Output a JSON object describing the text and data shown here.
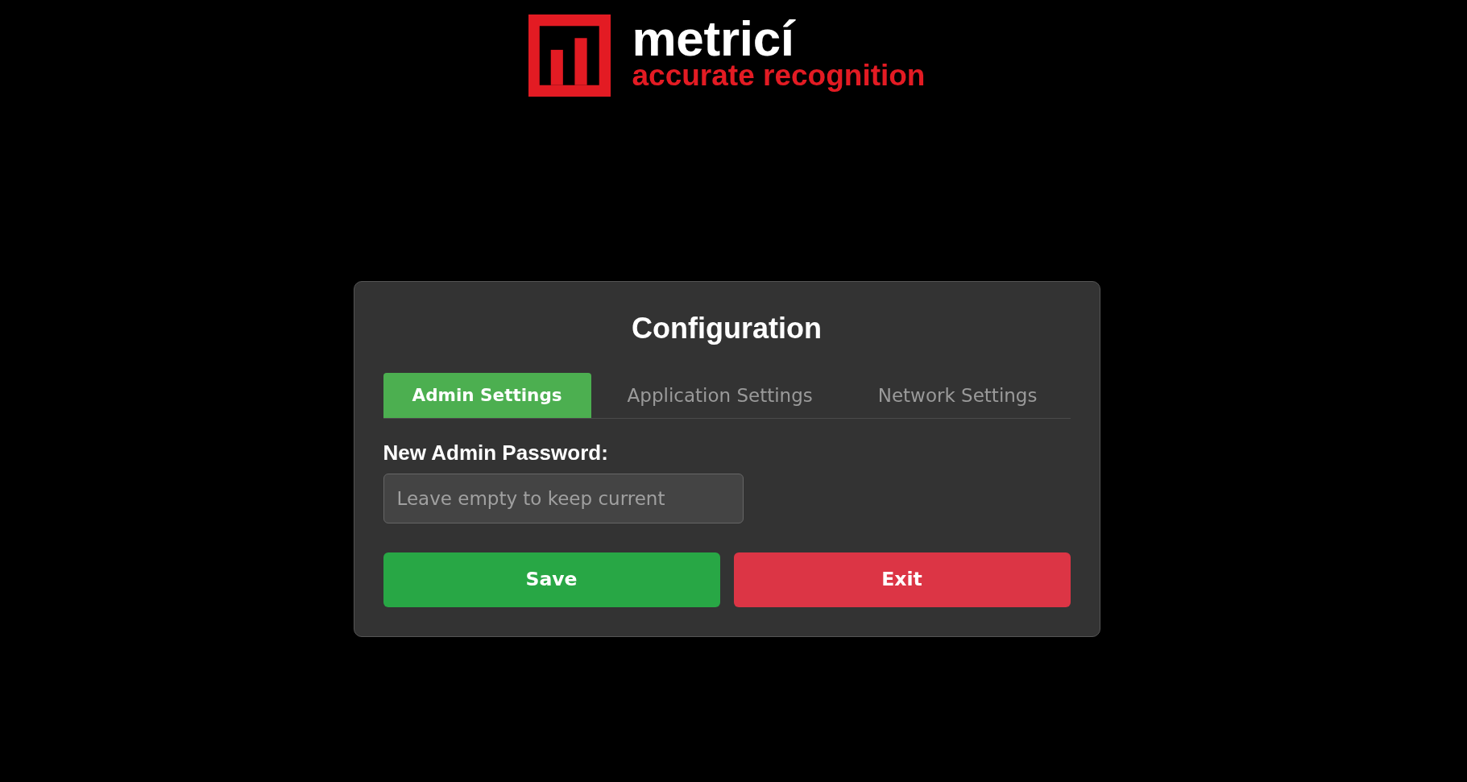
{
  "logo": {
    "name": "metricí",
    "tagline": "accurate recognition"
  },
  "dialog": {
    "title": "Configuration",
    "tabs": [
      {
        "label": "Admin Settings",
        "selected": true
      },
      {
        "label": "Application Settings",
        "selected": false
      },
      {
        "label": "Network Settings",
        "selected": false
      }
    ],
    "fields": [
      {
        "label": "New Admin Password:",
        "placeholder": "Leave empty to keep current"
      }
    ],
    "buttons": [
      {
        "label": "Save",
        "kind": "primary"
      },
      {
        "label": "Exit",
        "kind": "danger"
      }
    ]
  }
}
